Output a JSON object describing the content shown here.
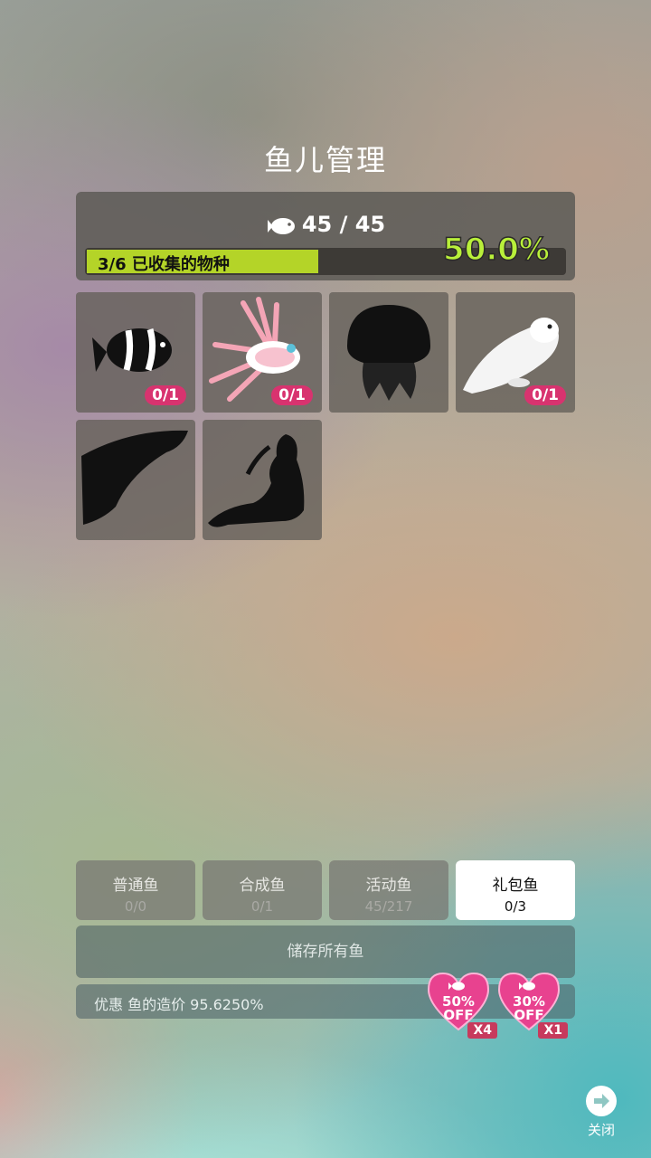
{
  "header": {
    "title": "鱼儿管理"
  },
  "summary": {
    "fish_count": "45 / 45",
    "collected_label": "3/6 已收集的物种",
    "collected_fraction": 0.5,
    "percent": "50.0%"
  },
  "fish_tiles": [
    {
      "name": "clownfish",
      "count": "0/1"
    },
    {
      "name": "lionfish",
      "count": "0/1"
    },
    {
      "name": "jellyfish-silhouette",
      "count": ""
    },
    {
      "name": "seal",
      "count": "0/1"
    },
    {
      "name": "whale-silhouette",
      "count": ""
    },
    {
      "name": "mermaid-silhouette",
      "count": ""
    }
  ],
  "tabs": [
    {
      "label": "普通鱼",
      "count": "0/0"
    },
    {
      "label": "合成鱼",
      "count": "0/1"
    },
    {
      "label": "活动鱼",
      "count": "45/217"
    },
    {
      "label": "礼包鱼",
      "count": "0/3"
    }
  ],
  "store_all": "储存所有鱼",
  "discount_text": "优惠 鱼的造价 95.6250%",
  "offers": [
    {
      "line1": "50%",
      "line2": "OFF",
      "multiplier": "X4"
    },
    {
      "line1": "30%",
      "line2": "OFF",
      "multiplier": "X1"
    }
  ],
  "close_label": "关闭",
  "colors": {
    "accent_green": "#b4d428",
    "badge_pink": "#d8336f",
    "heart_pink": "#e8428f"
  }
}
